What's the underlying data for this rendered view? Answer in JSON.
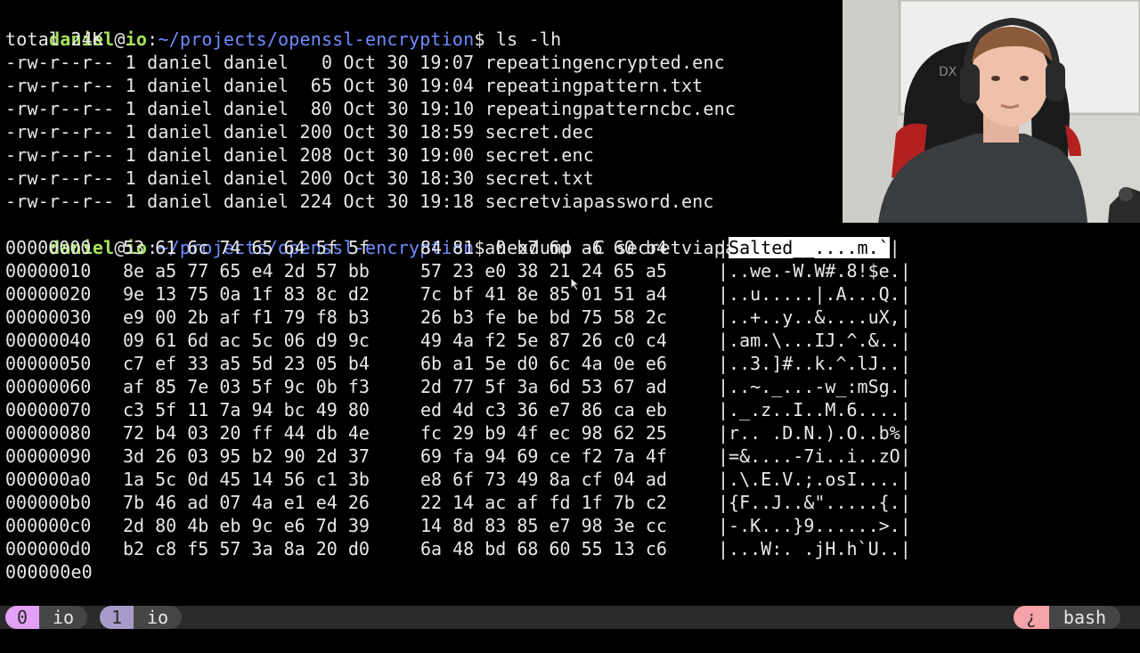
{
  "prompt": {
    "user": "daniel",
    "at": "@",
    "host": "io",
    "colon": ":",
    "path": "~/projects/openssl-encryption",
    "dollar": "$"
  },
  "commands": {
    "ls": " ls -lh",
    "hexdump": " hexdump -C secretviapassword.enc"
  },
  "ls_output": {
    "total": "total 24K",
    "files": [
      "-rw-r--r-- 1 daniel daniel   0 Oct 30 19:07 repeatingencrypted.enc",
      "-rw-r--r-- 1 daniel daniel  65 Oct 30 19:04 repeatingpattern.txt",
      "-rw-r--r-- 1 daniel daniel  80 Oct 30 19:10 repeatingpatterncbc.enc",
      "-rw-r--r-- 1 daniel daniel 200 Oct 30 18:59 secret.dec",
      "-rw-r--r-- 1 daniel daniel 208 Oct 30 19:00 secret.enc",
      "-rw-r--r-- 1 daniel daniel 200 Oct 30 18:30 secret.txt",
      "-rw-r--r-- 1 daniel daniel 224 Oct 30 19:18 secretviapassword.enc"
    ]
  },
  "hexdump": {
    "rows": [
      {
        "offset": "00000000",
        "a": "53 61 6c 74 65 64 5f 5f",
        "b": "84 81 a0 b7 6d a6 60 b4",
        "ascii_hl": "Salted__....m.`",
        "ascii_rest": "",
        "bar": "|"
      },
      {
        "offset": "00000010",
        "a": "8e a5 77 65 e4 2d 57 bb",
        "b": "57 23 e0 38 21 24 65 a5",
        "ascii": "|..we.-W.W#.8!$e.|"
      },
      {
        "offset": "00000020",
        "a": "9e 13 75 0a 1f 83 8c d2",
        "b": "7c bf 41 8e 85 01 51 a4",
        "ascii": "|..u.....|.A...Q.|"
      },
      {
        "offset": "00000030",
        "a": "e9 00 2b af f1 79 f8 b3",
        "b": "26 b3 fe be bd 75 58 2c",
        "ascii": "|..+..y..&....uX,|"
      },
      {
        "offset": "00000040",
        "a": "09 61 6d ac 5c 06 d9 9c",
        "b": "49 4a f2 5e 87 26 c0 c4",
        "ascii": "|.am.\\...IJ.^.&..|"
      },
      {
        "offset": "00000050",
        "a": "c7 ef 33 a5 5d 23 05 b4",
        "b": "6b a1 5e d0 6c 4a 0e e6",
        "ascii": "|..3.]#..k.^.lJ..|"
      },
      {
        "offset": "00000060",
        "a": "af 85 7e 03 5f 9c 0b f3",
        "b": "2d 77 5f 3a 6d 53 67 ad",
        "ascii": "|..~._...-w_:mSg.|"
      },
      {
        "offset": "00000070",
        "a": "c3 5f 11 7a 94 bc 49 80",
        "b": "ed 4d c3 36 e7 86 ca eb",
        "ascii": "|._.z..I..M.6....|"
      },
      {
        "offset": "00000080",
        "a": "72 b4 03 20 ff 44 db 4e",
        "b": "fc 29 b9 4f ec 98 62 25",
        "ascii": "|r.. .D.N.).O..b%|"
      },
      {
        "offset": "00000090",
        "a": "3d 26 03 95 b2 90 2d 37",
        "b": "69 fa 94 69 ce f2 7a 4f",
        "ascii": "|=&....-7i..i..zO|"
      },
      {
        "offset": "000000a0",
        "a": "1a 5c 0d 45 14 56 c1 3b",
        "b": "e8 6f 73 49 8a cf 04 ad",
        "ascii": "|.\\.E.V.;.osI....|"
      },
      {
        "offset": "000000b0",
        "a": "7b 46 ad 07 4a e1 e4 26",
        "b": "22 14 ac af fd 1f 7b c2",
        "ascii": "|{F..J..&\".....{.|"
      },
      {
        "offset": "000000c0",
        "a": "2d 80 4b eb 9c e6 7d 39",
        "b": "14 8d 83 85 e7 98 3e cc",
        "ascii": "|-.K...}9......>.|"
      },
      {
        "offset": "000000d0",
        "a": "b2 c8 f5 57 3a 8a 20 d0",
        "b": "6a 48 bd 68 60 55 13 c6",
        "ascii": "|...W:. .jH.h`U..|"
      }
    ],
    "end_offset": "000000e0"
  },
  "status_bar": {
    "windows": [
      {
        "index": "0",
        "name": "io"
      },
      {
        "index": "1",
        "name": "io"
      }
    ],
    "right_icon": "¿",
    "right_label": "bash"
  },
  "colors": {
    "user": "#a6e35a",
    "path": "#6f8cff",
    "pill_active": "#e3a0f7",
    "pill_inactive": "#a69bc9",
    "pill_right": "#f5a3a8"
  }
}
